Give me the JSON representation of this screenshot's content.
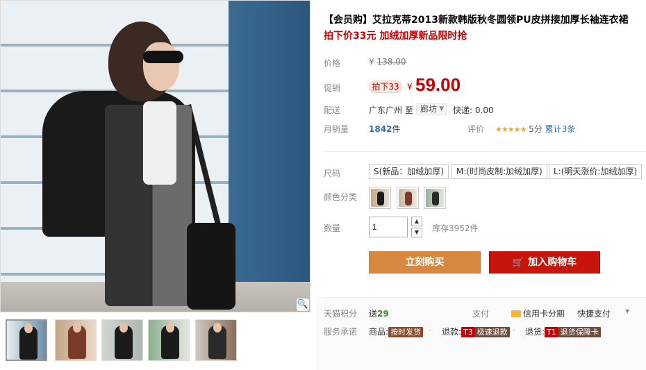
{
  "product": {
    "title": "【会员购】艾拉克蒂2013新款韩版秋冬圆领PU皮拼接加厚长袖连衣裙",
    "subtitle": "拍下价33元 加绒加厚新品限时抢"
  },
  "price": {
    "label": "价格",
    "currency": "¥",
    "original": "138.00"
  },
  "promo": {
    "label": "促销",
    "tag": "拍下33",
    "currency": "¥",
    "price": "59.00"
  },
  "shipping": {
    "label": "配送",
    "origin": "广东广州",
    "to": "至",
    "destination": "廊坊",
    "fee_label": "快递:",
    "fee": "0.00"
  },
  "sales": {
    "label": "月销量",
    "count": "1842",
    "unit": "件",
    "rating_label": "评价",
    "stars": "★★★★★",
    "score": "5分",
    "reviews": "累计3条"
  },
  "size": {
    "label": "尺码",
    "options": [
      "S(新品：加绒加厚)",
      "M:(时尚皮制:加绒加厚)",
      "L:(明天涨价:加绒加厚)"
    ]
  },
  "color": {
    "label": "颜色分类"
  },
  "quantity": {
    "label": "数量",
    "value": "1",
    "up": "▲",
    "down": "▼",
    "stock": "库存3952件"
  },
  "buttons": {
    "buy": "立刻购买",
    "cart": "加入购物车"
  },
  "bottom": {
    "points_label": "天猫积分",
    "points_prefix": "送",
    "points": "29",
    "pay_label": "支付",
    "credit": "信用卡分期",
    "quick": "快捷支付",
    "more": "▾",
    "service_label": "服务承诺",
    "goods": "商品:",
    "goods_badge": "按时发货",
    "refund": "退款:",
    "refund_code": "T3",
    "refund_badge": "极速退款",
    "return": "退货:",
    "return_code": "T1",
    "return_badge": "退货保障卡",
    "dot": "·"
  },
  "zoom_icon": "🔍",
  "colors": {
    "accent_red": "#c40000",
    "buy_orange": "#d8873f",
    "cart_red": "#c7150b"
  }
}
